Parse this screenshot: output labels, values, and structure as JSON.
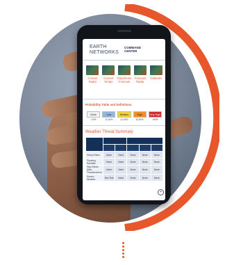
{
  "brand": {
    "logo_line1": "EARTH",
    "logo_line2": "NETWORKS",
    "app_line1": "COMMAND",
    "app_line2": "CENTER"
  },
  "tiles": [
    {
      "label": "Current Radar",
      "icon": "radar-map"
    },
    {
      "label": "Current Temps",
      "icon": "temperature-map"
    },
    {
      "label": "Rain/Snow Forecast",
      "icon": "precip-map"
    },
    {
      "label": "Forecast Radar",
      "icon": "forecast-radar-map"
    },
    {
      "label": "Outlooks",
      "icon": "outlook-map"
    }
  ],
  "probability": {
    "title": "Probability Table and Definitions",
    "levels": [
      {
        "label": "None",
        "color": "#f2f2f2"
      },
      {
        "label": "Low",
        "color": "#8fb7e0"
      },
      {
        "label": "Medium",
        "color": "#f3d23a"
      },
      {
        "label": "High",
        "color": "#f2921e"
      },
      {
        "label": "Very High",
        "color": "#d8272a"
      }
    ],
    "percents": [
      "<10%",
      "10-40%",
      "41-60%",
      "61-80%",
      ">80%"
    ]
  },
  "threat": {
    "title": "Weather Threat Summary",
    "date": "June 17, 2022",
    "regions": [
      "New England",
      "Mid-Atl Region"
    ],
    "days": [
      "June 17",
      "June 18",
      "June 17",
      "June 18",
      "June"
    ],
    "rows": [
      {
        "label": "Heavy Rains",
        "values": [
          "None",
          "None",
          "None",
          "None",
          "None"
        ]
      },
      {
        "label": "Flooding Rainfalls",
        "values": [
          "None",
          "None",
          "None",
          "None",
          "None"
        ]
      },
      {
        "label": "High Winds (Non-Thunderstorm)",
        "values": [
          "None",
          "None",
          "None",
          "None",
          "None"
        ]
      },
      {
        "label": "Severe Weather",
        "values": [
          "See Text",
          "None",
          "None",
          "None",
          "None"
        ]
      }
    ]
  },
  "colors": {
    "accent": "#e8572b",
    "navy": "#12305a"
  }
}
